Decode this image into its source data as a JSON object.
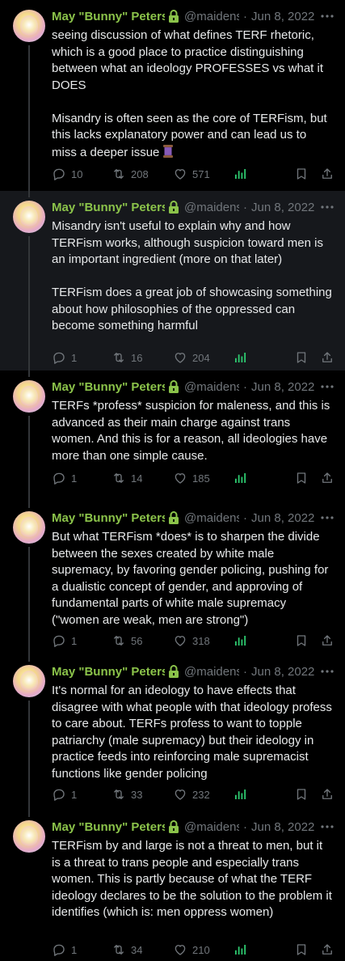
{
  "colors": {
    "name": "#8bc34a",
    "muted": "#71767b",
    "views": "#2ecc71",
    "highlight_bg": "#16181c"
  },
  "icons": {
    "lock": "lock-icon",
    "more": "more-icon",
    "reply": "reply-icon",
    "retweet": "retweet-icon",
    "like": "like-icon",
    "views": "views-icon",
    "bookmark": "bookmark-icon",
    "share": "share-icon",
    "emoji": "thread-spool-emoji"
  },
  "tweets": [
    {
      "name": "May \"Bunny\" Peters",
      "handle": "@maidens",
      "dot": "·",
      "date": "Jun 8, 2022",
      "text": "seeing discussion of what defines TERF rhetoric, which is a good place to practice distinguishing between what an ideology PROFESSES vs what it DOES\n\nMisandry is often seen as the core of TERFism, but this lacks explanatory power and can lead us to miss a deeper issue",
      "replies": "10",
      "retweets": "208",
      "likes": "571"
    },
    {
      "name": "May \"Bunny\" Peters",
      "handle": "@maidens",
      "dot": "·",
      "date": "Jun 8, 2022",
      "text": "Misandry isn't useful to explain why and how TERFism works, although suspicion toward men is an important ingredient (more on that later)\n\nTERFism does a great job of showcasing something about how philosophies of the oppressed can become something harmful",
      "replies": "1",
      "retweets": "16",
      "likes": "204"
    },
    {
      "name": "May \"Bunny\" Peters",
      "handle": "@maidens",
      "dot": "·",
      "date": "Jun 8, 2022",
      "text": "TERFs *profess* suspicion for maleness, and this is advanced as their main charge against trans women. And this is for a reason, all ideologies have more than one simple cause.",
      "replies": "1",
      "retweets": "14",
      "likes": "185"
    },
    {
      "name": "May \"Bunny\" Peters",
      "handle": "@maidens",
      "dot": "·",
      "date": "Jun 8, 2022",
      "text": "But what TERFism *does* is to sharpen the divide between the sexes created by white male supremacy, by favoring gender policing, pushing for a dualistic concept of gender, and approving of fundamental parts of white male supremacy (\"women are weak, men are strong\")",
      "replies": "1",
      "retweets": "56",
      "likes": "318"
    },
    {
      "name": "May \"Bunny\" Peters",
      "handle": "@maidens",
      "dot": "·",
      "date": "Jun 8, 2022",
      "text": "It's normal for an ideology to have effects that disagree with what people with that ideology profess to care about. TERFs profess to want to topple patriarchy (male supremacy) but their ideology in practice feeds into reinforcing male supremacist functions like gender policing",
      "replies": "1",
      "retweets": "33",
      "likes": "232"
    },
    {
      "name": "May \"Bunny\" Peters",
      "handle": "@maidens",
      "dot": "·",
      "date": "Jun 8, 2022",
      "text": "TERFism by and large is not a threat to men, but it is a threat to trans people and especially trans women. This is partly because of what the TERF ideology declares to be the solution to the problem it identifies (which is: men oppress women)",
      "replies": "1",
      "retweets": "34",
      "likes": "210"
    }
  ]
}
